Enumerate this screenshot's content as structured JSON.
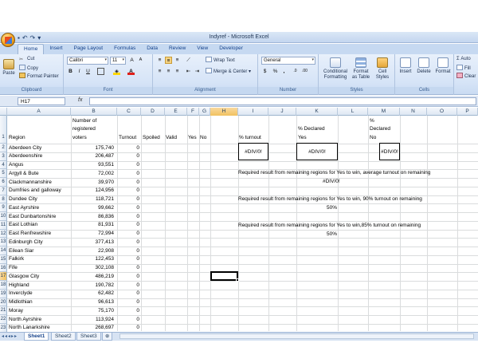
{
  "window": {
    "title": "Indyref - Microsoft Excel"
  },
  "tabs": [
    "Home",
    "Insert",
    "Page Layout",
    "Formulas",
    "Data",
    "Review",
    "View",
    "Developer"
  ],
  "ribbon": {
    "clipboard": {
      "paste": "Paste",
      "cut": "Cut",
      "copy": "Copy",
      "format_painter": "Format Painter",
      "label": "Clipboard"
    },
    "font": {
      "name": "Calibri",
      "size": "11",
      "label": "Font"
    },
    "alignment": {
      "wrap_text": "Wrap Text",
      "merge_center": "Merge & Center",
      "label": "Alignment"
    },
    "number": {
      "format": "General",
      "percent": "%",
      "comma": ",",
      "label": "Number"
    },
    "styles": {
      "conditional": "Conditional",
      "conditional2": "Formatting",
      "format_as": "Format",
      "format_as2": "as Table",
      "cell_styles": "Cell",
      "cell_styles2": "Styles",
      "label": "Styles"
    },
    "cells": {
      "insert": "Insert",
      "delete": "Delete",
      "format": "Format",
      "label": "Cells"
    },
    "editing": {
      "sum": "Σ Auto",
      "fill": "Fill",
      "clear": "Clear"
    }
  },
  "formula_bar": {
    "name_box": "H17",
    "fx": "fx",
    "formula": ""
  },
  "columns": [
    "A",
    "B",
    "C",
    "D",
    "E",
    "F",
    "G",
    "H",
    "I",
    "J",
    "K",
    "L",
    "M",
    "N",
    "O",
    "P"
  ],
  "selected_column": "H",
  "selected_row": "17",
  "header_row": {
    "region": "Region",
    "voters_l1": "Number of",
    "voters_l2": "registered",
    "voters_l3": "voters",
    "turnout": "Turnout",
    "spoiled": "Spoiled",
    "valid": "Valid",
    "yes": "Yes",
    "no": "No",
    "pct_turnout": "% turnout",
    "pct_yes_l1": "% Declared",
    "pct_yes_l2": "Yes",
    "pct_no_l1": "%",
    "pct_no_l2": "Declared",
    "pct_no_l3": "No"
  },
  "rows": [
    {
      "n": "2",
      "region": "Aberdeen City",
      "voters": "175,740",
      "turnout": "0"
    },
    {
      "n": "3",
      "region": "Aberdeenshire",
      "voters": "206,487",
      "turnout": "0"
    },
    {
      "n": "4",
      "region": "Angus",
      "voters": "93,551",
      "turnout": "0"
    },
    {
      "n": "5",
      "region": "Argyll & Bute",
      "voters": "72,002",
      "turnout": "0"
    },
    {
      "n": "6",
      "region": "Clackmannanshire",
      "voters": "39,970",
      "turnout": "0"
    },
    {
      "n": "7",
      "region": "Dumfries and galloway",
      "voters": "124,956",
      "turnout": "0"
    },
    {
      "n": "8",
      "region": "Dundee City",
      "voters": "118,721",
      "turnout": "0"
    },
    {
      "n": "9",
      "region": "East Ayrshire",
      "voters": "99,662",
      "turnout": "0"
    },
    {
      "n": "10",
      "region": "East Dunbartonshire",
      "voters": "86,836",
      "turnout": "0"
    },
    {
      "n": "11",
      "region": "East Lothian",
      "voters": "81,931",
      "turnout": "0"
    },
    {
      "n": "12",
      "region": "East Renfrewshire",
      "voters": "72,994",
      "turnout": "0"
    },
    {
      "n": "13",
      "region": "Edinburgh City",
      "voters": "377,413",
      "turnout": "0"
    },
    {
      "n": "14",
      "region": "Eilean Siar",
      "voters": "22,908",
      "turnout": "0"
    },
    {
      "n": "15",
      "region": "Falkirk",
      "voters": "122,453",
      "turnout": "0"
    },
    {
      "n": "16",
      "region": "Fife",
      "voters": "302,108",
      "turnout": "0"
    },
    {
      "n": "17",
      "region": "Glasgow City",
      "voters": "486,219",
      "turnout": "0"
    },
    {
      "n": "18",
      "region": "Highland",
      "voters": "190,782",
      "turnout": "0"
    },
    {
      "n": "19",
      "region": "Inverclyde",
      "voters": "62,482",
      "turnout": "0"
    },
    {
      "n": "20",
      "region": "Midlothian",
      "voters": "96,613",
      "turnout": "0"
    },
    {
      "n": "21",
      "region": "Moray",
      "voters": "75,170",
      "turnout": "0"
    },
    {
      "n": "22",
      "region": "North Ayrshire",
      "voters": "113,924",
      "turnout": "0"
    },
    {
      "n": "23",
      "region": "North Lanarkshire",
      "voters": "268,697",
      "turnout": "0"
    }
  ],
  "results": {
    "turnout": "#DIV/0!",
    "yes": "#DIV/0!",
    "no": "#DIV/0!"
  },
  "notes": {
    "n1_l1": "Required result from remaining regions for Yes to win, average turnout on remaining",
    "n1_l2": "#DIV/0!",
    "n2_l1": "Required result from remaining regions for Yes to win, 90% turnout on remaining",
    "n2_l2": "50%",
    "n3_l1": "Required result from remaining regions for Yes to win,85% turnout on remaining",
    "n3_l2": "50%"
  },
  "sheets": [
    "Sheet1",
    "Sheet2",
    "Sheet3"
  ]
}
